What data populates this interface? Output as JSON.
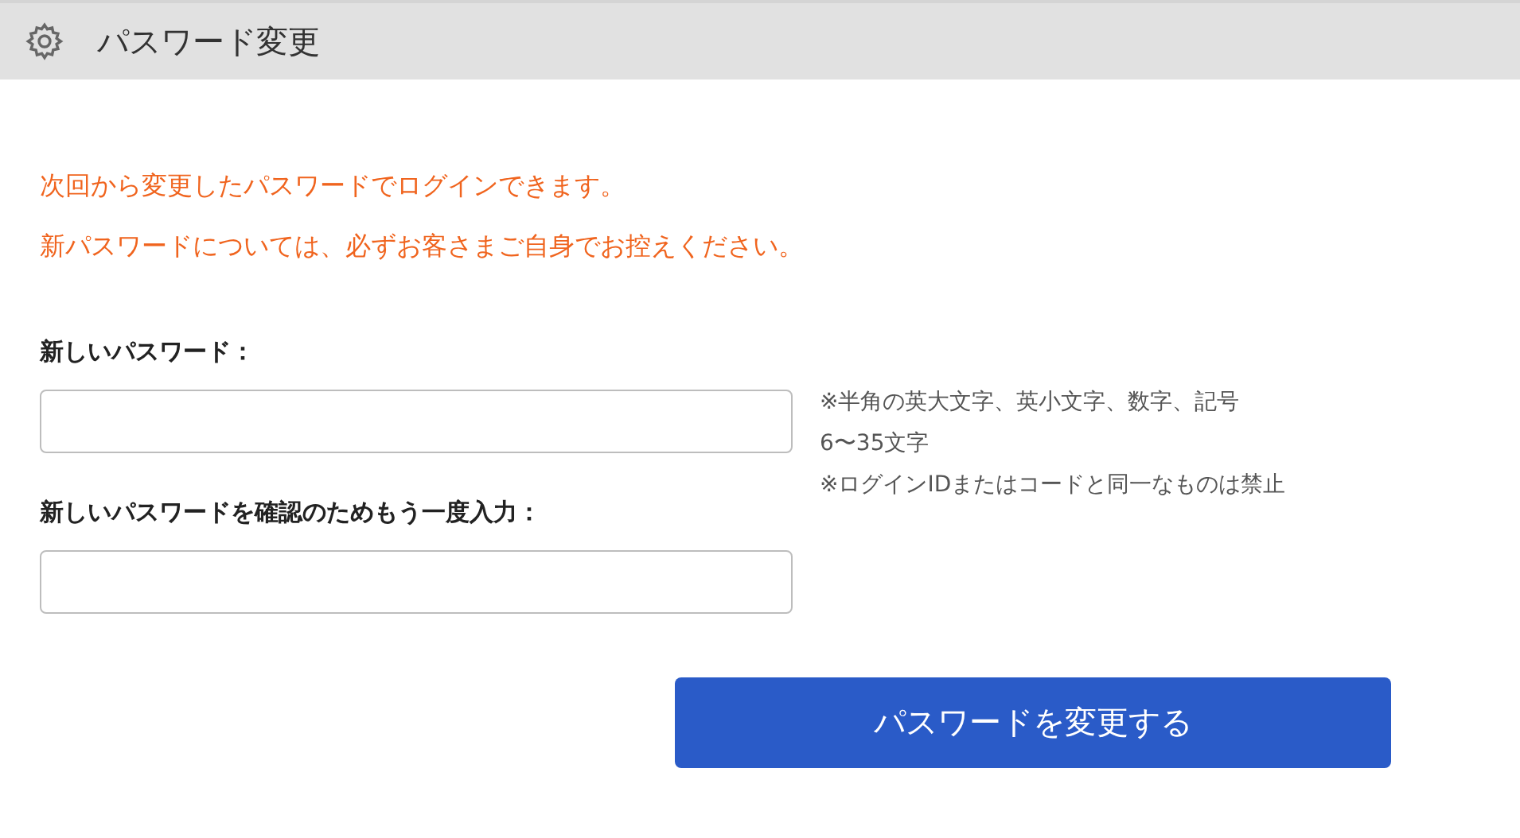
{
  "header": {
    "title": "パスワード変更"
  },
  "notices": [
    "次回から変更したパスワードでログインできます。",
    "新パスワードについては、必ずお客さまご自身でお控えください。"
  ],
  "fields": [
    {
      "label": "新しいパスワード："
    },
    {
      "label": "新しいパスワードを確認のためもう一度入力："
    }
  ],
  "hints": [
    "※半角の英大文字、英小文字、数字、記号",
    "6〜35文字",
    "※ログインIDまたはコードと同一なものは禁止"
  ],
  "submit": {
    "label": "パスワードを変更する"
  }
}
